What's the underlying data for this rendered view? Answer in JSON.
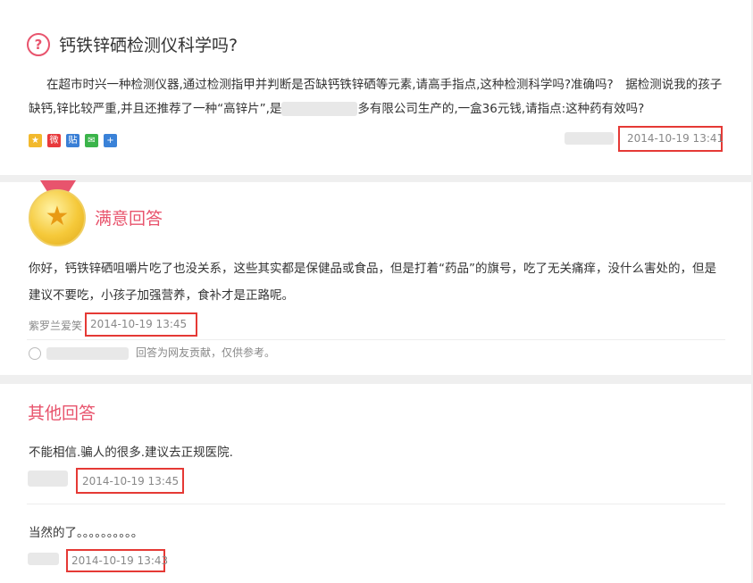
{
  "question": {
    "icon": "question-icon",
    "title": "钙铁锌硒检测仪科学吗?",
    "body_part1": "在超市时兴一种检测仪器,通过检测指甲并判断是否缺钙铁锌硒等元素,请高手指点,这种检测科学吗?准确吗?　据检测说我的孩子缺钙,锌比较严重,并且还推荐了一种“高锌片”,是",
    "body_part2": "多有限公司生产的,一盒36元钱,请指点:这种药有效吗?",
    "time": "2014-10-19 13:41",
    "share_icons": [
      "qzone-icon",
      "weibo-icon",
      "tieba-icon",
      "wechat-icon",
      "more-share-icon"
    ]
  },
  "best_answer": {
    "title": "满意回答",
    "body": "你好，钙铁锌硒咀嚼片吃了也没关系，这些其实都是保健品或食品，但是打着“药品”的旗号，吃了无关痛痒，没什么害处的，但是建议不要吃，小孩子加强营养，食补才是正路呢。",
    "author": "紫罗兰爱笑",
    "time": "2014-10-19 13:45",
    "note": "回答为网友贡献，仅供参考。"
  },
  "other_answers": {
    "title": "其他回答",
    "items": [
      {
        "text": "不能相信.骗人的很多.建议去正规医院.",
        "time": "2014-10-19 13:45"
      },
      {
        "text": "当然的了。。。。。。。。。。",
        "time": "2014-10-19 13:43"
      }
    ]
  },
  "colors": {
    "accent": "#e8546d",
    "highlight_box": "#e53935"
  }
}
